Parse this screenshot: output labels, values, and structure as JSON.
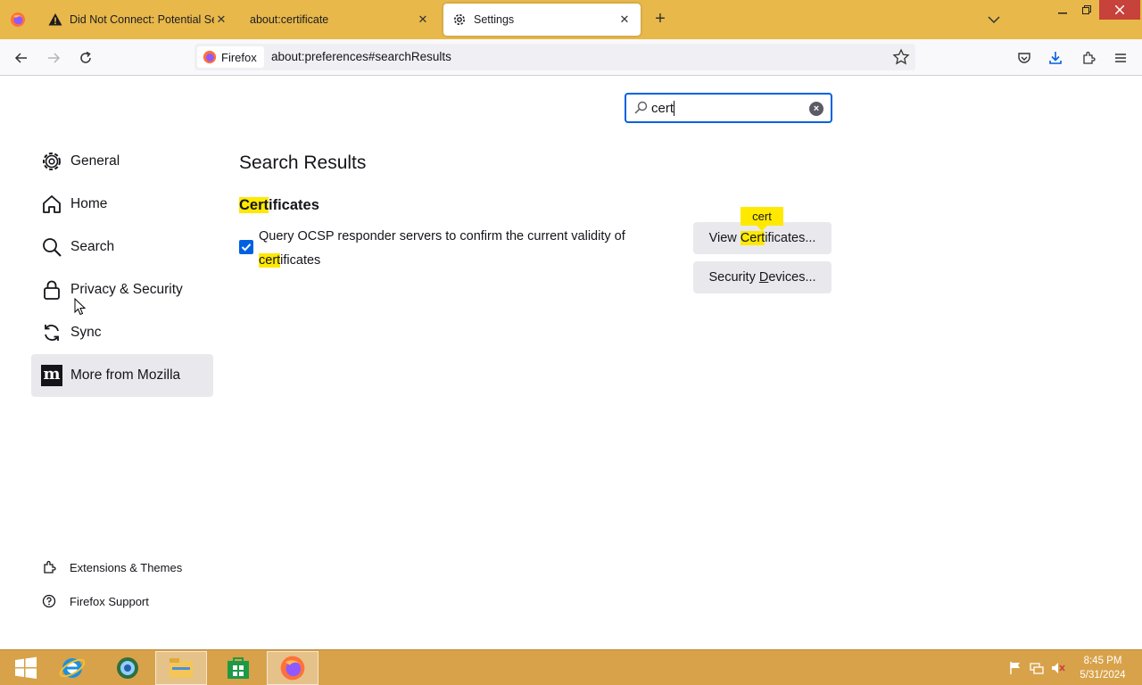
{
  "browser": {
    "tabs": [
      {
        "label": "Did Not Connect: Potential Security Issue",
        "icon": "warning-icon",
        "active": false
      },
      {
        "label": "about:certificate",
        "icon": "",
        "active": false
      },
      {
        "label": "Settings",
        "icon": "gear-icon",
        "active": true
      }
    ],
    "identity_label": "Firefox",
    "url": "about:preferences#searchResults"
  },
  "search": {
    "value": "cert"
  },
  "sidebar": {
    "items": [
      {
        "label": "General",
        "icon": "gear-icon"
      },
      {
        "label": "Home",
        "icon": "home-icon"
      },
      {
        "label": "Search",
        "icon": "search-icon"
      },
      {
        "label": "Privacy & Security",
        "icon": "lock-icon"
      },
      {
        "label": "Sync",
        "icon": "sync-icon"
      },
      {
        "label": "More from Mozilla",
        "icon": "mozilla-icon",
        "selected": true
      }
    ],
    "footer": [
      {
        "label": "Extensions & Themes",
        "icon": "puzzle-icon"
      },
      {
        "label": "Firefox Support",
        "icon": "help-icon"
      }
    ]
  },
  "main": {
    "heading": "Search Results",
    "section": {
      "title_hl": "Cert",
      "title_rest": "ificates"
    },
    "ocsp": {
      "checked": true,
      "line1": "Query OCSP responder servers to confirm the current validity of",
      "line2_hl": "cert",
      "line2_rest": "ificates"
    },
    "buttons": {
      "view_pre": "View ",
      "view_hl": "Cert",
      "view_post": "ificates...",
      "security_pre": "Security ",
      "security_acc": "D",
      "security_post": "evices..."
    },
    "tooltip": "cert"
  },
  "taskbar": {
    "time": "8:45 PM",
    "date": "5/31/2024"
  },
  "colors": {
    "tabstrip": "#e8b84a",
    "accent": "#0061e0",
    "highlight": "#ffe900",
    "taskbar": "#d8a24a"
  }
}
